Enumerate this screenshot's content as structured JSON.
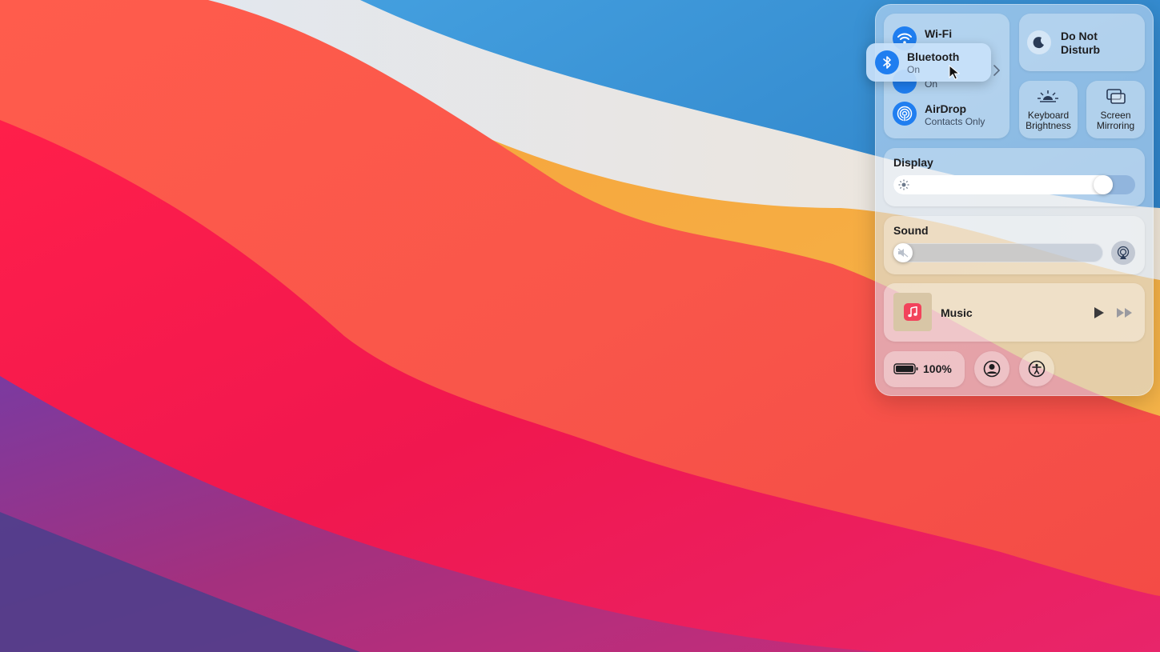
{
  "control_center": {
    "wifi": {
      "label": "Wi-Fi",
      "status": ""
    },
    "bluetooth": {
      "label": "Bluetooth",
      "status": "On"
    },
    "airdrop": {
      "label": "AirDrop",
      "status": "Contacts Only"
    },
    "do_not_disturb": {
      "label_line1": "Do Not",
      "label_line2": "Disturb"
    },
    "keyboard_brightness": {
      "label_line1": "Keyboard",
      "label_line2": "Brightness"
    },
    "screen_mirroring": {
      "label_line1": "Screen",
      "label_line2": "Mirroring"
    },
    "display": {
      "label": "Display",
      "brightness_level": 0.9
    },
    "sound": {
      "label": "Sound",
      "volume_level": 0.0
    },
    "music": {
      "label": "Music"
    },
    "battery": {
      "percent_label": "100%"
    }
  },
  "popup": {
    "label": "Bluetooth",
    "status": "On",
    "obscured_status": "On"
  },
  "colors": {
    "accent": "#1f7ef0",
    "music_icon": "#f2435b"
  },
  "icons": [
    "wifi-icon",
    "bluetooth-icon",
    "airdrop-icon",
    "moon-icon",
    "keyboard-brightness-icon",
    "screen-mirroring-icon",
    "sun-icon",
    "mute-icon",
    "airplay-audio-icon",
    "music-note-icon",
    "play-icon",
    "fast-forward-icon",
    "battery-icon",
    "user-icon",
    "accessibility-icon",
    "chevron-right-icon",
    "mouse-cursor-icon"
  ]
}
